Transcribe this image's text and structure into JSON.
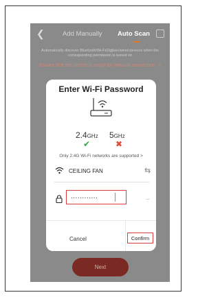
{
  "header": {
    "tab_manual": "Add Manually",
    "tab_auto": "Auto Scan"
  },
  "banner": {
    "description": "Automatically discover Bluetooth/Wi-Fi/Zigbee/wired devices when the corresponding permission is turned on",
    "ensure": "Ensure that the device is ready for network connection. >"
  },
  "dialog": {
    "title": "Enter Wi-Fi Password",
    "band_24": {
      "value": "2.4",
      "unit": "GHz"
    },
    "band_5": {
      "value": "5",
      "unit": "GHz"
    },
    "band_note": "Only 2.4G Wi-Fi networks are supported >",
    "wifi_name": "CEILING FAN",
    "password_value": "............",
    "cancel_label": "Cancel",
    "confirm_label": "Confirm"
  },
  "next_label": "Next",
  "colors": {
    "accent": "#e07a2a",
    "highlight_border": "#d93a3a",
    "check": "#2aaa3a",
    "cross": "#e04b3a"
  }
}
